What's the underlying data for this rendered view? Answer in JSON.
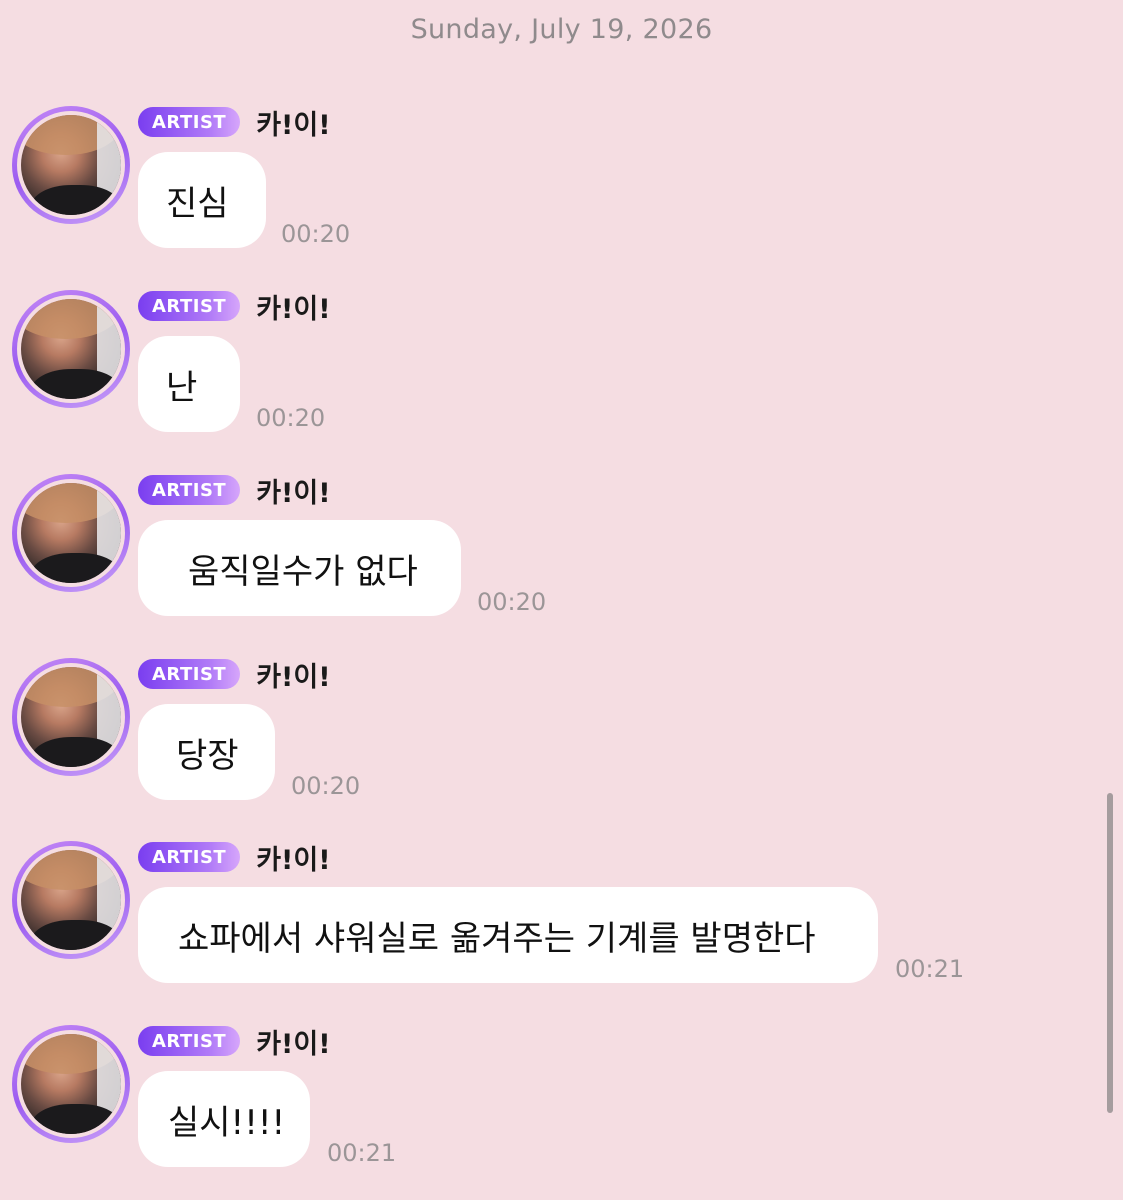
{
  "date_header": "Sunday, July 19, 2026",
  "badge_label": "ARTIST",
  "messages": [
    {
      "sender": "카!이!",
      "text": "진심",
      "time": "00:20"
    },
    {
      "sender": "카!이!",
      "text": "난",
      "time": "00:20"
    },
    {
      "sender": "카!이!",
      "text": "움직일수가 없다",
      "time": "00:20"
    },
    {
      "sender": "카!이!",
      "text": "당장",
      "time": "00:20"
    },
    {
      "sender": "카!이!",
      "text": "쇼파에서 샤워실로 옮겨주는 기계를 발명한다",
      "time": "00:21"
    },
    {
      "sender": "카!이!",
      "text": "실시!!!!",
      "time": "00:21"
    }
  ],
  "colors": {
    "background": "#f5dde2",
    "badge_start": "#7a3ef0",
    "badge_end": "#d6a6fb",
    "bubble": "#ffffff",
    "timestamp": "#9b9597"
  }
}
